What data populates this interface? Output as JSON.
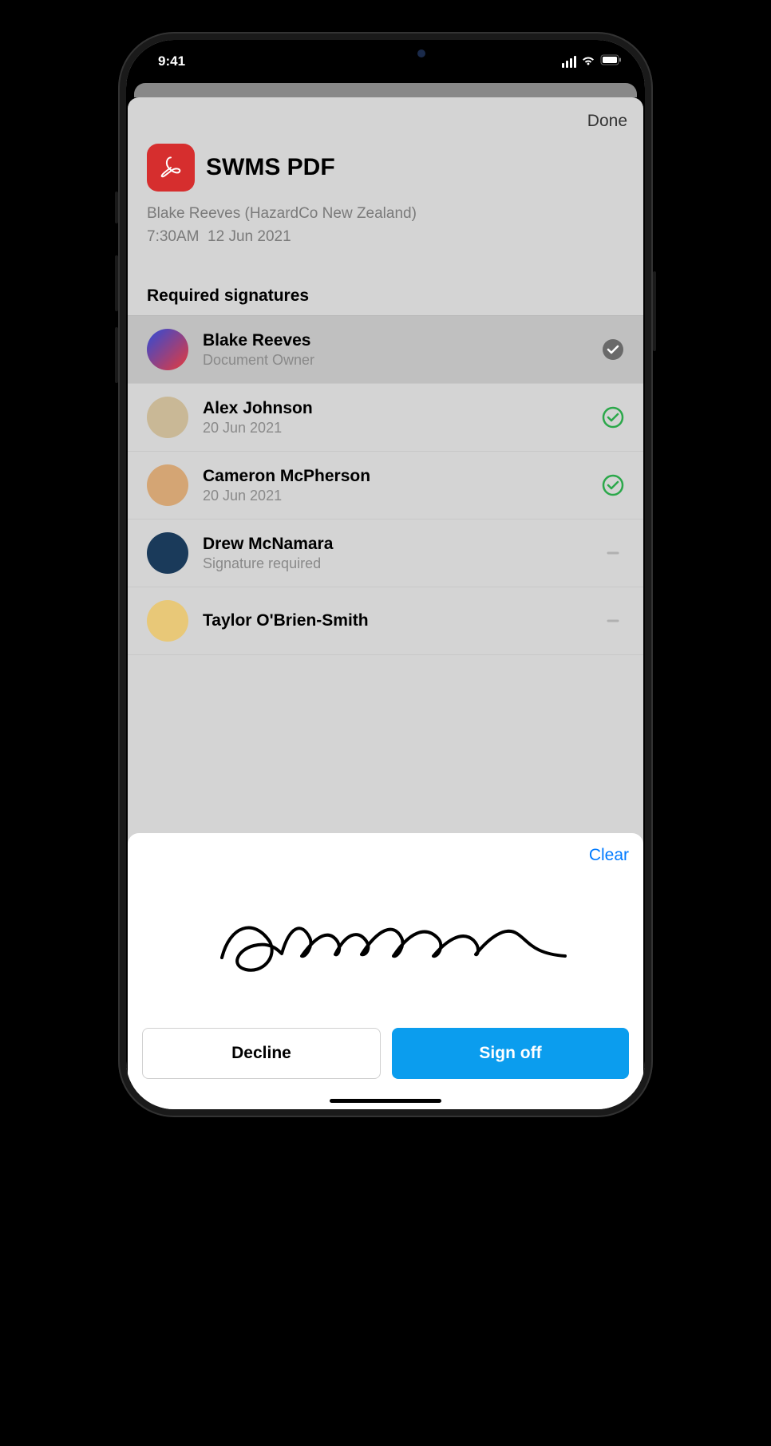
{
  "statusBar": {
    "time": "9:41"
  },
  "modal": {
    "done": "Done",
    "docTitle": "SWMS PDF",
    "docOwner": "Blake Reeves (HazardCo New Zealand)",
    "docTime": "7:30AM",
    "docDate": "12 Jun 2021",
    "sectionTitle": "Required signatures"
  },
  "signers": [
    {
      "name": "Blake Reeves",
      "sub": "Document Owner",
      "status": "owner-check",
      "avatarColor": "linear-gradient(135deg,#2e4bd8,#e83a3a)"
    },
    {
      "name": "Alex Johnson",
      "sub": "20 Jun 2021",
      "status": "signed",
      "avatarColor": "#c9b896"
    },
    {
      "name": "Cameron McPherson",
      "sub": "20 Jun 2021",
      "status": "signed",
      "avatarColor": "#d4a574"
    },
    {
      "name": "Drew McNamara",
      "sub": "Signature required",
      "status": "pending",
      "avatarColor": "#1a3a5a"
    },
    {
      "name": "Taylor O'Brien-Smith",
      "sub": "",
      "status": "pending",
      "avatarColor": "#e8c878"
    }
  ],
  "panel": {
    "clear": "Clear",
    "decline": "Decline",
    "signoff": "Sign off"
  }
}
